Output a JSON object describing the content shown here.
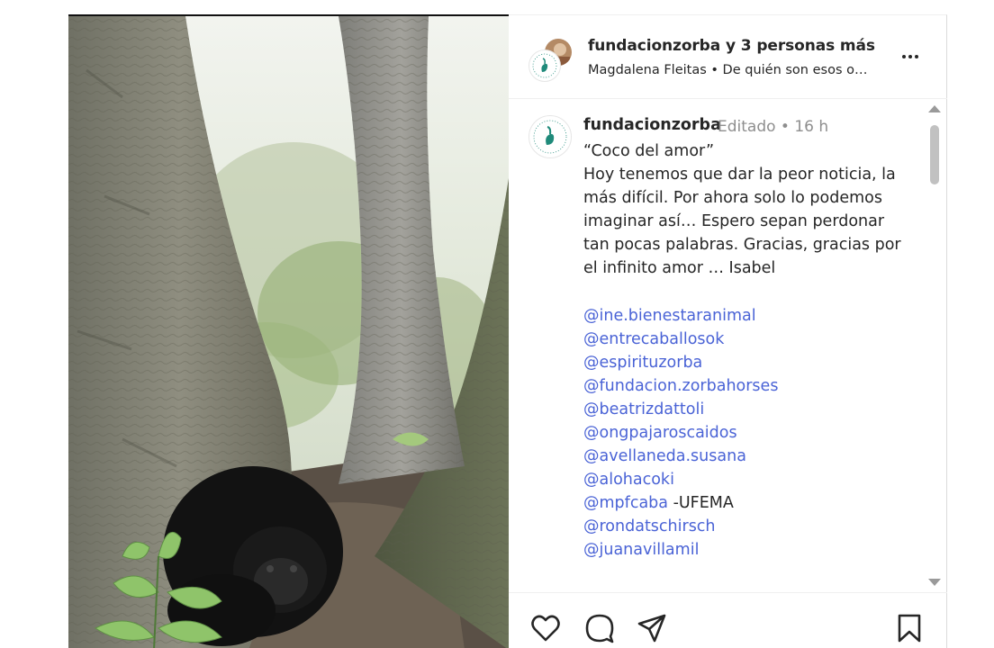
{
  "header": {
    "account": "fundacionzorba",
    "others": "y 3 personas más",
    "subtitle": "Magdalena Fleitas • De quién son esos o…"
  },
  "caption": {
    "username": "fundacionzorba",
    "meta": "Editado • 16 h",
    "text": "“Coco del amor”\nHoy tenemos que dar la peor noticia, la más difícil. Por ahora solo lo podemos imaginar así… Espero sepan perdonar tan pocas palabras. Gracias, gracias por el infinito amor … Isabel",
    "mentions": [
      {
        "handle": "@ine.bienestaranimal",
        "suffix": ""
      },
      {
        "handle": "@entrecaballosok",
        "suffix": ""
      },
      {
        "handle": "@espirituzorba",
        "suffix": ""
      },
      {
        "handle": "@fundacion.zorbahorses",
        "suffix": ""
      },
      {
        "handle": "@beatrizdattoli",
        "suffix": ""
      },
      {
        "handle": "@ongpajaroscaidos",
        "suffix": ""
      },
      {
        "handle": "@avellaneda.susana",
        "suffix": ""
      },
      {
        "handle": "@alohacoki",
        "suffix": ""
      },
      {
        "handle": "@mpfcaba",
        "suffix": " -UFEMA"
      },
      {
        "handle": "@rondatschirsch",
        "suffix": ""
      },
      {
        "handle": "@juanavillamil",
        "suffix": ""
      }
    ]
  },
  "actions": {
    "icons": [
      "heart-icon",
      "comment-icon",
      "share-icon",
      "bookmark-icon"
    ]
  },
  "colors": {
    "mention": "#4a63d6",
    "muted": "#8e8e8e",
    "logo_teal": "#1f8a7a"
  }
}
